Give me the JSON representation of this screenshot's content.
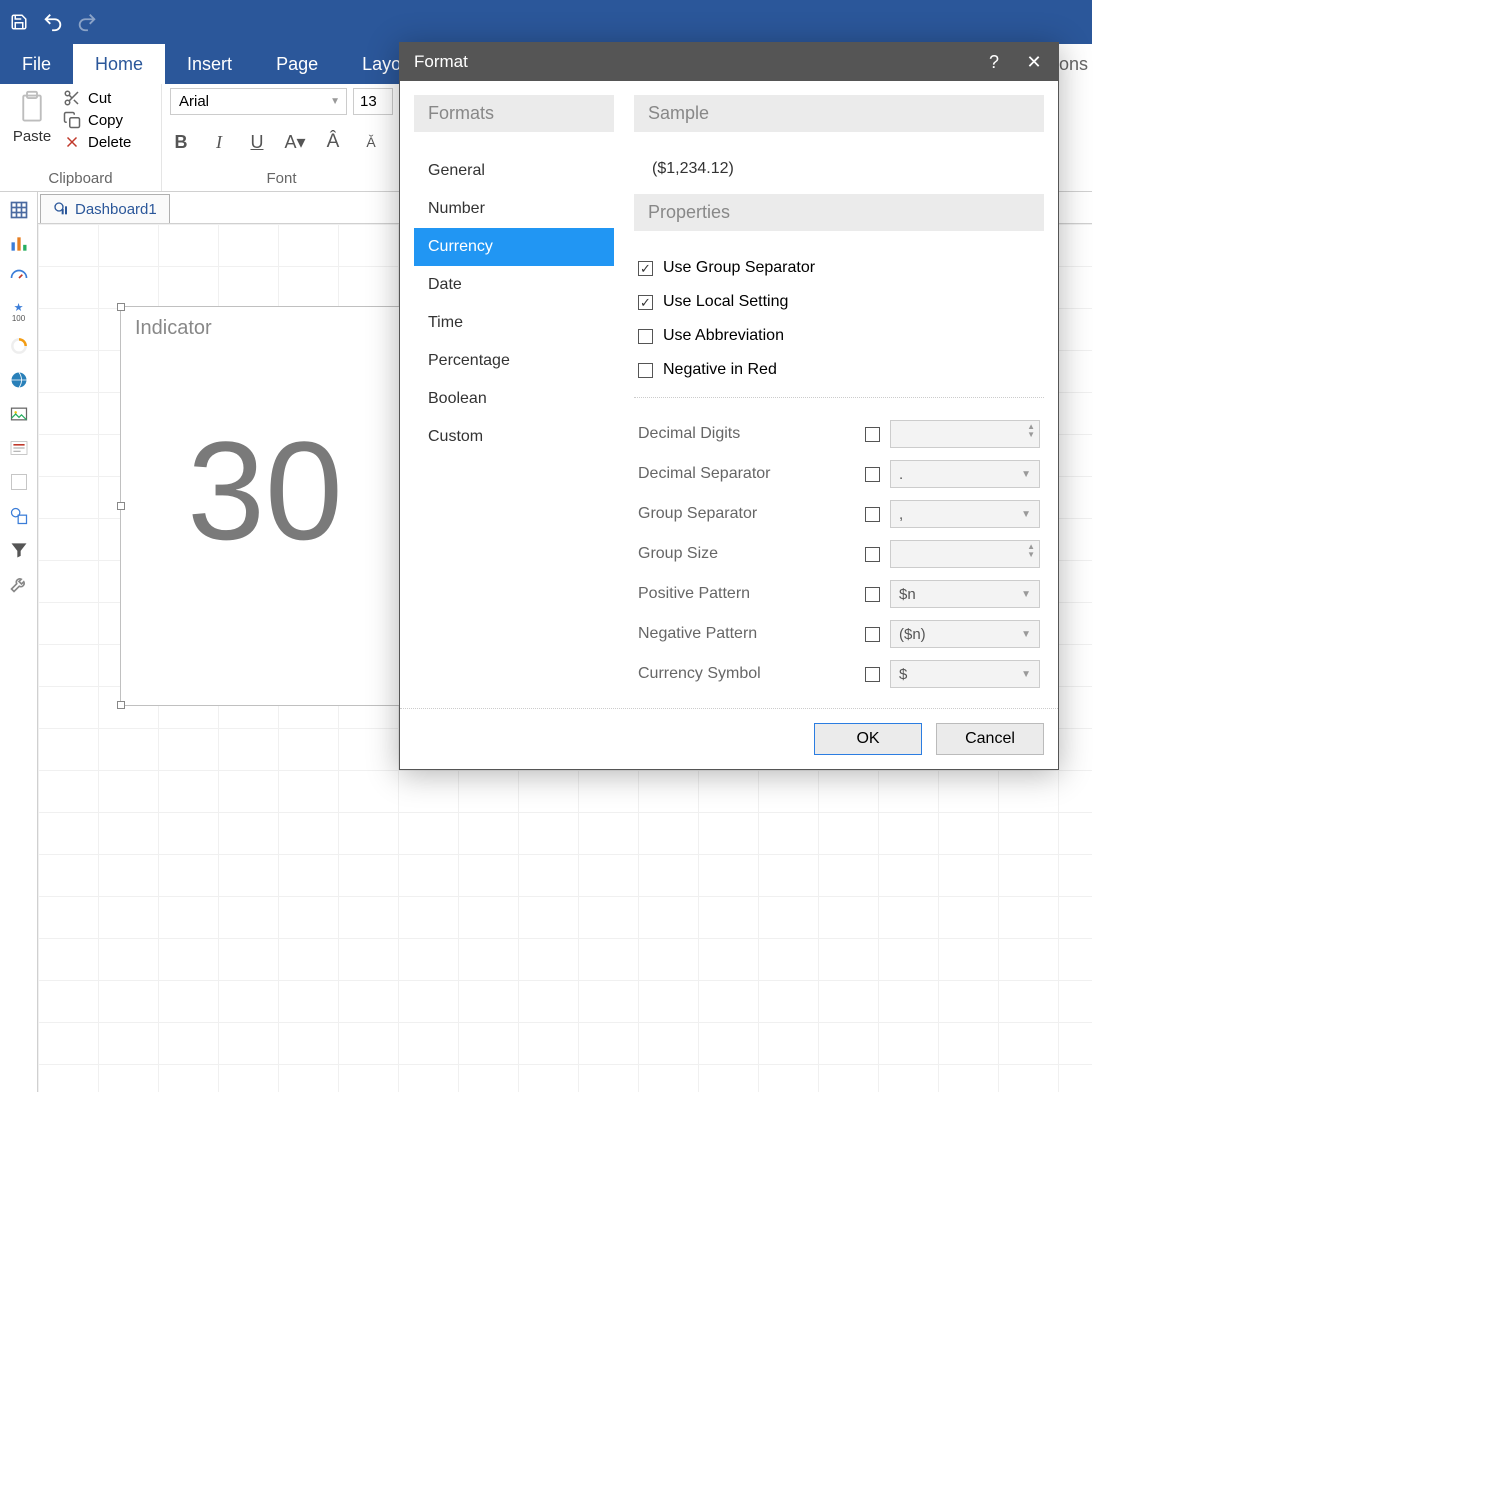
{
  "titlebar": {},
  "menu": {
    "tabs": [
      "File",
      "Home",
      "Insert",
      "Page",
      "Layout"
    ],
    "active": 1,
    "right_partial": "tions"
  },
  "ribbon": {
    "clipboard": {
      "paste": "Paste",
      "cut": "Cut",
      "copy": "Copy",
      "delete": "Delete",
      "group": "Clipboard"
    },
    "font": {
      "name": "Arial",
      "size": "13",
      "group": "Font"
    }
  },
  "doc_tab": "Dashboard1",
  "indicator": {
    "title": "Indicator",
    "value": "30"
  },
  "dialog": {
    "title": "Format",
    "sections": {
      "formats": "Formats",
      "sample": "Sample",
      "properties": "Properties"
    },
    "format_list": [
      "General",
      "Number",
      "Currency",
      "Date",
      "Time",
      "Percentage",
      "Boolean",
      "Custom"
    ],
    "format_selected": 2,
    "sample_value": "($1,234.12)",
    "checks": [
      {
        "label": "Use Group Separator",
        "checked": true
      },
      {
        "label": "Use Local Setting",
        "checked": true
      },
      {
        "label": "Use Abbreviation",
        "checked": false
      },
      {
        "label": "Negative in Red",
        "checked": false
      }
    ],
    "props": [
      {
        "label": "Decimal Digits",
        "value": "",
        "type": "spin"
      },
      {
        "label": "Decimal Separator",
        "value": ".",
        "type": "drop"
      },
      {
        "label": "Group Separator",
        "value": ",",
        "type": "drop"
      },
      {
        "label": "Group Size",
        "value": "",
        "type": "spin"
      },
      {
        "label": "Positive Pattern",
        "value": "$n",
        "type": "drop"
      },
      {
        "label": "Negative Pattern",
        "value": "($n)",
        "type": "drop"
      },
      {
        "label": "Currency Symbol",
        "value": "$",
        "type": "drop"
      }
    ],
    "buttons": {
      "ok": "OK",
      "cancel": "Cancel"
    }
  }
}
